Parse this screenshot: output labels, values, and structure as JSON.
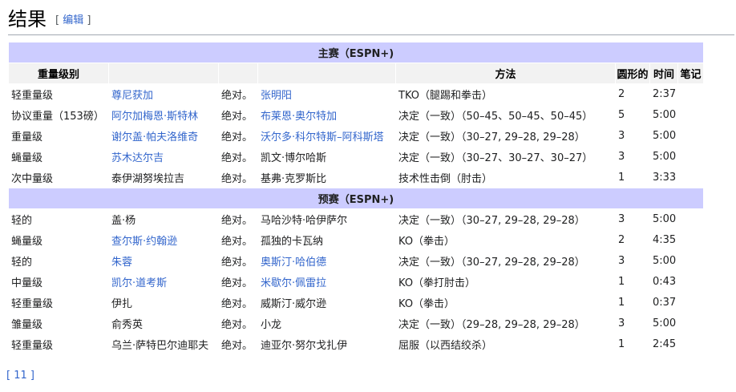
{
  "heading": {
    "title": "结果",
    "edit_open": "[",
    "edit_label": "编辑",
    "edit_close": "]"
  },
  "table": {
    "headers": {
      "weight": "重量级别",
      "method": "方法",
      "rounds": "圆形的",
      "time": "时间",
      "notes": "笔记"
    },
    "sections": [
      {
        "title": "主赛（ESPN+)",
        "rows": [
          {
            "weight": "轻重量级",
            "winner": "尊尼获加",
            "winner_link": true,
            "vs": "绝对。",
            "loser": "张明阳",
            "loser_link": true,
            "method": "TKO（腿踢和拳击）",
            "round": "2",
            "time": "2:37",
            "notes": ""
          },
          {
            "weight": "协议重量（153磅）",
            "winner": "阿尔加梅恩·斯特林",
            "winner_link": true,
            "vs": "绝对。",
            "loser": "布莱恩·奥尔特加",
            "loser_link": true,
            "method": "决定（一致）（50–45、50–45、50–45）",
            "round": "5",
            "time": "5:00",
            "notes": ""
          },
          {
            "weight": "重量级",
            "winner": "谢尔盖·帕夫洛维奇",
            "winner_link": true,
            "vs": "绝对。",
            "loser": "沃尔多·科尔特斯–阿科斯塔",
            "loser_link": true,
            "method": "决定（一致）（30–27, 29–28, 29–28）",
            "round": "3",
            "time": "5:00",
            "notes": ""
          },
          {
            "weight": "蝇量级",
            "winner": "苏木达尔吉",
            "winner_link": true,
            "vs": "绝对。",
            "loser": "凯文·博尔哈斯",
            "loser_link": false,
            "method": "决定（一致）（30–27、30–27、30–27）",
            "round": "3",
            "time": "5:00",
            "notes": ""
          },
          {
            "weight": "次中量级",
            "winner": "泰伊湖努埃拉吉",
            "winner_link": false,
            "vs": "绝对。",
            "loser": "基弗·克罗斯比",
            "loser_link": false,
            "method": "技术性击倒（肘击）",
            "round": "1",
            "time": "3:33",
            "notes": ""
          }
        ]
      },
      {
        "title": "预赛（ESPN+)",
        "rows": [
          {
            "weight": "轻的",
            "winner": "盖·杨",
            "winner_link": false,
            "vs": "绝对。",
            "loser": "马哈沙特·哈伊萨尔",
            "loser_link": false,
            "method": "决定（一致）（30–27, 29–28, 29–28）",
            "round": "3",
            "time": "5:00",
            "notes": ""
          },
          {
            "weight": "蝇量级",
            "winner": "查尔斯·约翰逊",
            "winner_link": true,
            "vs": "绝对。",
            "loser": "孤独的卡瓦纳",
            "loser_link": false,
            "method": "KO（拳击）",
            "round": "2",
            "time": "4:35",
            "notes": ""
          },
          {
            "weight": "轻的",
            "winner": "朱蓉",
            "winner_link": true,
            "vs": "绝对。",
            "loser": "奥斯汀·哈伯德",
            "loser_link": true,
            "method": "决定（一致）（30–27, 29–28, 29–28）",
            "round": "3",
            "time": "5:00",
            "notes": ""
          },
          {
            "weight": "中量级",
            "winner": "凯尔·道考斯",
            "winner_link": true,
            "vs": "绝对。",
            "loser": "米歇尔·佩雷拉",
            "loser_link": true,
            "method": "KO（拳打肘击）",
            "round": "1",
            "time": "0:43",
            "notes": ""
          },
          {
            "weight": "轻重量级",
            "winner": "伊扎",
            "winner_link": false,
            "vs": "绝对。",
            "loser": "威斯汀·威尔逊",
            "loser_link": false,
            "method": "KO（拳击）",
            "round": "1",
            "time": "0:37",
            "notes": ""
          },
          {
            "weight": "雏量级",
            "winner": "俞秀英",
            "winner_link": false,
            "vs": "绝对。",
            "loser": "小龙",
            "loser_link": false,
            "method": "决定（一致）（29–28, 29–28, 29–28）",
            "round": "3",
            "time": "5:00",
            "notes": ""
          },
          {
            "weight": "轻重量级",
            "winner": "乌兰·萨特巴尔迪耶夫",
            "winner_link": false,
            "vs": "绝对。",
            "loser": "迪亚尔·努尔戈扎伊",
            "loser_link": false,
            "method": "屈服（以西结绞杀）",
            "round": "1",
            "time": "2:45",
            "notes": ""
          }
        ]
      }
    ]
  },
  "footnote": "[ 11 ]",
  "colors": {
    "link": "#3366cc",
    "section_bg": "#ccccff",
    "header_bg": "#f2f2f2",
    "rule": "#a2a9b1"
  }
}
